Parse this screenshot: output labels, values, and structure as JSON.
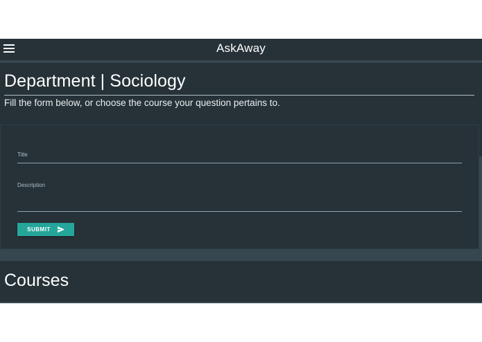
{
  "app": {
    "title": "AskAway",
    "menu_icon": "hamburger-menu-icon"
  },
  "department": {
    "title": "Department | Sociology",
    "subtitle": "Fill the form below, or choose the course your question pertains to."
  },
  "form": {
    "title_label": "Title",
    "title_value": "",
    "description_label": "Description",
    "description_value": "",
    "submit_label": "SUBMIT",
    "submit_icon": "send-icon"
  },
  "courses": {
    "title": "Courses"
  },
  "colors": {
    "background": "#37474f",
    "surface": "#263238",
    "accent": "#26a69a",
    "text": "#ffffff"
  }
}
